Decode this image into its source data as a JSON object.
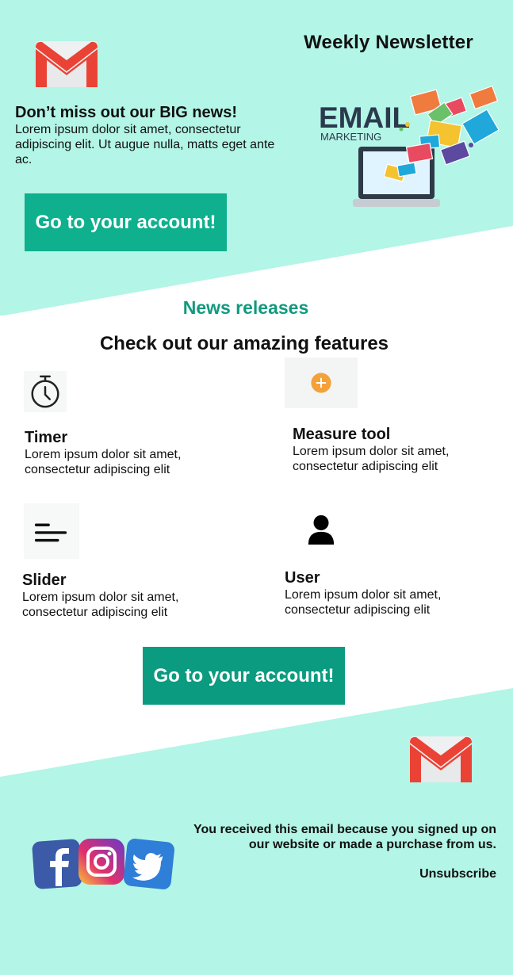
{
  "header": {
    "newsletter_title": "Weekly Newsletter",
    "headline": "Don’t miss out our BIG news!",
    "intro": "Lorem ipsum dolor sit amet, consectetur adipiscing elit. Ut augue nulla, matts eget ante ac.",
    "cta_label": "Go to your account!",
    "email_marketing_word1": "EMAIL",
    "email_marketing_word2": "MARKETING"
  },
  "features": {
    "section_label": "News releases",
    "title": "Check out our amazing features",
    "items": [
      {
        "title": "Timer",
        "desc": "Lorem ipsum dolor sit amet, consectetur adipiscing elit",
        "icon": "timer-icon"
      },
      {
        "title": "Measure tool",
        "desc": "Lorem ipsum dolor sit amet, consectetur adipiscing elit",
        "icon": "add-icon"
      },
      {
        "title": "Slider",
        "desc": "Lorem ipsum dolor sit amet, consectetur adipiscing elit",
        "icon": "menu-lines-icon"
      },
      {
        "title": "User",
        "desc": "Lorem ipsum dolor sit amet, consectetur adipiscing elit",
        "icon": "user-icon"
      }
    ],
    "cta_label": "Go to your account!"
  },
  "footer": {
    "notice": "You received this email because you signed up on our website or made a purchase from us.",
    "unsubscribe": "Unsubscribe",
    "social": [
      "facebook-icon",
      "instagram-icon",
      "twitter-icon"
    ]
  },
  "colors": {
    "mint_background": "#b3f5e6",
    "accent_green": "#0aa68a",
    "gmail_red": "#ea4335"
  }
}
